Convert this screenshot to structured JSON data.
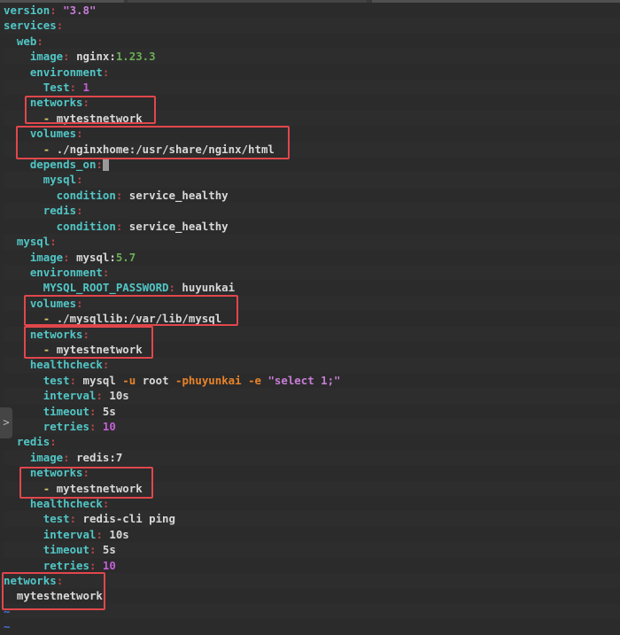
{
  "editor": {
    "lines": [
      [
        [
          "version",
          "k"
        ],
        [
          ": ",
          "p"
        ],
        [
          "\"3.8\"",
          "s"
        ]
      ],
      [
        [
          "services",
          "k"
        ],
        [
          ":",
          "p"
        ]
      ],
      [
        [
          "  web",
          "k"
        ],
        [
          ":",
          "p"
        ]
      ],
      [
        [
          "    image",
          "k"
        ],
        [
          ": ",
          "p"
        ],
        [
          "nginx:",
          "w"
        ],
        [
          "1.23.3",
          "n"
        ]
      ],
      [
        [
          "    environment",
          "k"
        ],
        [
          ":",
          "p"
        ]
      ],
      [
        [
          "      Test",
          "k"
        ],
        [
          ": ",
          "p"
        ],
        [
          "1",
          "m"
        ]
      ],
      [
        [
          "    networks",
          "k"
        ],
        [
          ":",
          "p"
        ]
      ],
      [
        [
          "      - ",
          "d"
        ],
        [
          "mytestnetwork",
          "w"
        ]
      ],
      [
        [
          "    volumes",
          "k"
        ],
        [
          ":",
          "p"
        ]
      ],
      [
        [
          "      - ",
          "d"
        ],
        [
          "./nginxhome:/usr/share/nginx/html",
          "w"
        ]
      ],
      [
        [
          "    depends_on",
          "k"
        ],
        [
          ":",
          "p"
        ],
        [
          "",
          "cursor"
        ]
      ],
      [
        [
          "      mysql",
          "k"
        ],
        [
          ":",
          "p"
        ]
      ],
      [
        [
          "        condition",
          "k"
        ],
        [
          ": ",
          "p"
        ],
        [
          "service_healthy",
          "w"
        ]
      ],
      [
        [
          "      redis",
          "k"
        ],
        [
          ":",
          "p"
        ]
      ],
      [
        [
          "        condition",
          "k"
        ],
        [
          ": ",
          "p"
        ],
        [
          "service_healthy",
          "w"
        ]
      ],
      [
        [
          "  mysql",
          "k"
        ],
        [
          ":",
          "p"
        ]
      ],
      [
        [
          "    image",
          "k"
        ],
        [
          ": ",
          "p"
        ],
        [
          "mysql:",
          "w"
        ],
        [
          "5.7",
          "n"
        ]
      ],
      [
        [
          "    environment",
          "k"
        ],
        [
          ":",
          "p"
        ]
      ],
      [
        [
          "      MYSQL_ROOT_PASSWORD",
          "k"
        ],
        [
          ": ",
          "p"
        ],
        [
          "huyunkai",
          "w"
        ]
      ],
      [
        [
          "    volumes",
          "k"
        ],
        [
          ":",
          "p"
        ]
      ],
      [
        [
          "      - ",
          "d"
        ],
        [
          "./mysqllib:/var/lib/mysql",
          "w"
        ]
      ],
      [
        [
          "    networks",
          "k"
        ],
        [
          ":",
          "p"
        ]
      ],
      [
        [
          "      - ",
          "d"
        ],
        [
          "mytestnetwork",
          "w"
        ]
      ],
      [
        [
          "    healthcheck",
          "k"
        ],
        [
          ":",
          "p"
        ]
      ],
      [
        [
          "      test",
          "k"
        ],
        [
          ": ",
          "p"
        ],
        [
          "mysql ",
          "w"
        ],
        [
          "-u ",
          "f"
        ],
        [
          "root ",
          "w"
        ],
        [
          "-phuyunkai ",
          "f"
        ],
        [
          "-e ",
          "f"
        ],
        [
          "\"select 1;\"",
          "s"
        ]
      ],
      [
        [
          "      interval",
          "k"
        ],
        [
          ": ",
          "p"
        ],
        [
          "10s",
          "w"
        ]
      ],
      [
        [
          "      timeout",
          "k"
        ],
        [
          ": ",
          "p"
        ],
        [
          "5s",
          "w"
        ]
      ],
      [
        [
          "      retries",
          "k"
        ],
        [
          ": ",
          "p"
        ],
        [
          "10",
          "m"
        ]
      ],
      [
        [
          "  redis",
          "k"
        ],
        [
          ":",
          "p"
        ]
      ],
      [
        [
          "    image",
          "k"
        ],
        [
          ": ",
          "p"
        ],
        [
          "redis:7",
          "w"
        ]
      ],
      [
        [
          "    networks",
          "k"
        ],
        [
          ":",
          "p"
        ]
      ],
      [
        [
          "      - ",
          "d"
        ],
        [
          "mytestnetwork",
          "w"
        ]
      ],
      [
        [
          "    healthcheck",
          "k"
        ],
        [
          ":",
          "p"
        ]
      ],
      [
        [
          "      test",
          "k"
        ],
        [
          ": ",
          "p"
        ],
        [
          "redis-cli ping",
          "w"
        ]
      ],
      [
        [
          "      interval",
          "k"
        ],
        [
          ": ",
          "p"
        ],
        [
          "10s",
          "w"
        ]
      ],
      [
        [
          "      timeout",
          "k"
        ],
        [
          ": ",
          "p"
        ],
        [
          "5s",
          "w"
        ]
      ],
      [
        [
          "      retries",
          "k"
        ],
        [
          ": ",
          "p"
        ],
        [
          "10",
          "m"
        ]
      ],
      [
        [
          "networks",
          "k"
        ],
        [
          ":",
          "p"
        ]
      ],
      [
        [
          "  mytestnetwork",
          "w"
        ]
      ],
      [
        [
          "~",
          "t"
        ]
      ],
      [
        [
          "~",
          "t"
        ]
      ]
    ]
  },
  "expander_icon": "chevron-right-icon",
  "expander_glyph": ">",
  "highlight_color": "#e0474c"
}
